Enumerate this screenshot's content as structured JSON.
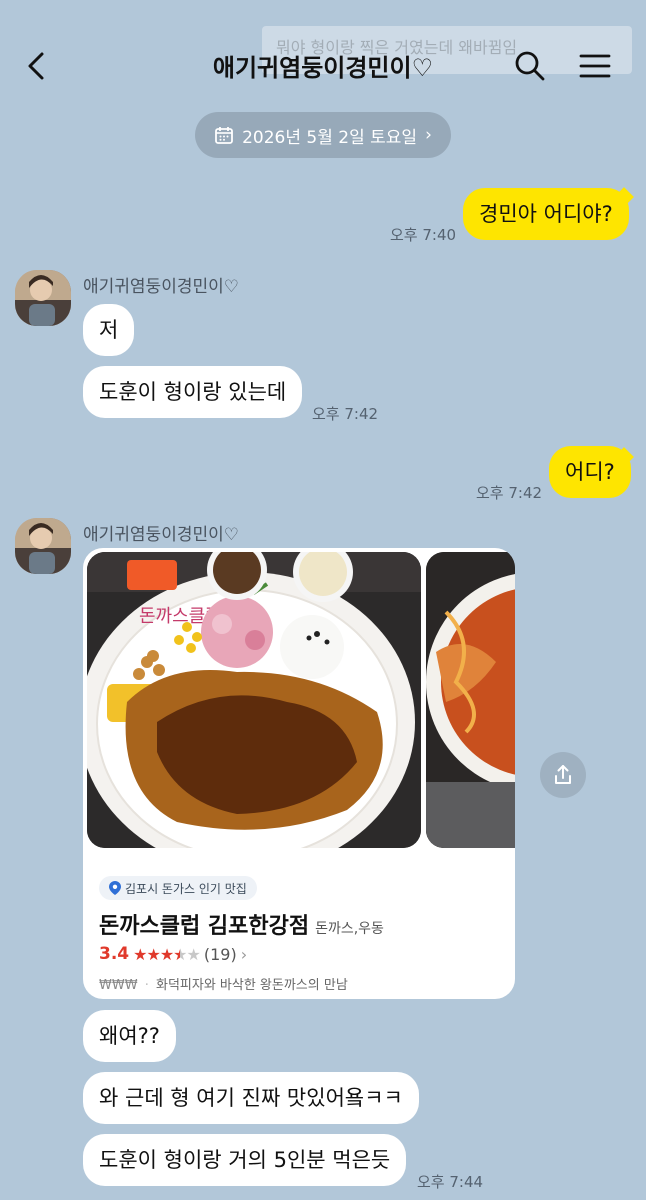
{
  "header": {
    "title": "애기귀염둥이경민이♡",
    "ghost_notice": "뭐야 형이랑 찍은 거였는데 왜바뀜임"
  },
  "date_divider": {
    "label": "2026년 5월 2일 토요일",
    "chevron": "›"
  },
  "sender_name": "애기귀염둥이경민이♡",
  "messages": {
    "m1": {
      "text": "경민아 어디야?",
      "time": "오후 7:40"
    },
    "m2": {
      "text": "저"
    },
    "m3": {
      "text": "도훈이 형이랑 있는데",
      "time": "오후 7:42"
    },
    "m4": {
      "text": "어디?",
      "time": "오후 7:42"
    },
    "m5": {
      "text": "왜여??"
    },
    "m6": {
      "text": "와 근데 형 여기 진짜 맛있어욬ㅋㅋ"
    },
    "m7": {
      "text": "도훈이 형이랑 거의 5인분 먹은듯",
      "time": "오후 7:44"
    }
  },
  "place_card": {
    "tag": "김포시 돈가스 인기 맛집",
    "name": "돈까스클럽 김포한강점",
    "category": "돈까스,우동",
    "rating": "3.4",
    "stars_filled": 3.5,
    "review_count": "(19)",
    "price_symbol": "₩₩₩",
    "description": "화덕피자와 바삭한 왕돈까스의 만남"
  },
  "icons": {
    "back": "chevron-left-icon",
    "search": "search-icon",
    "menu": "hamburger-menu-icon",
    "calendar": "calendar-icon",
    "share": "share-icon",
    "location": "location-pin-icon"
  },
  "colors": {
    "background": "#b2c7d9",
    "my_bubble": "#fee500",
    "other_bubble": "#ffffff",
    "rating": "#e0392b"
  }
}
